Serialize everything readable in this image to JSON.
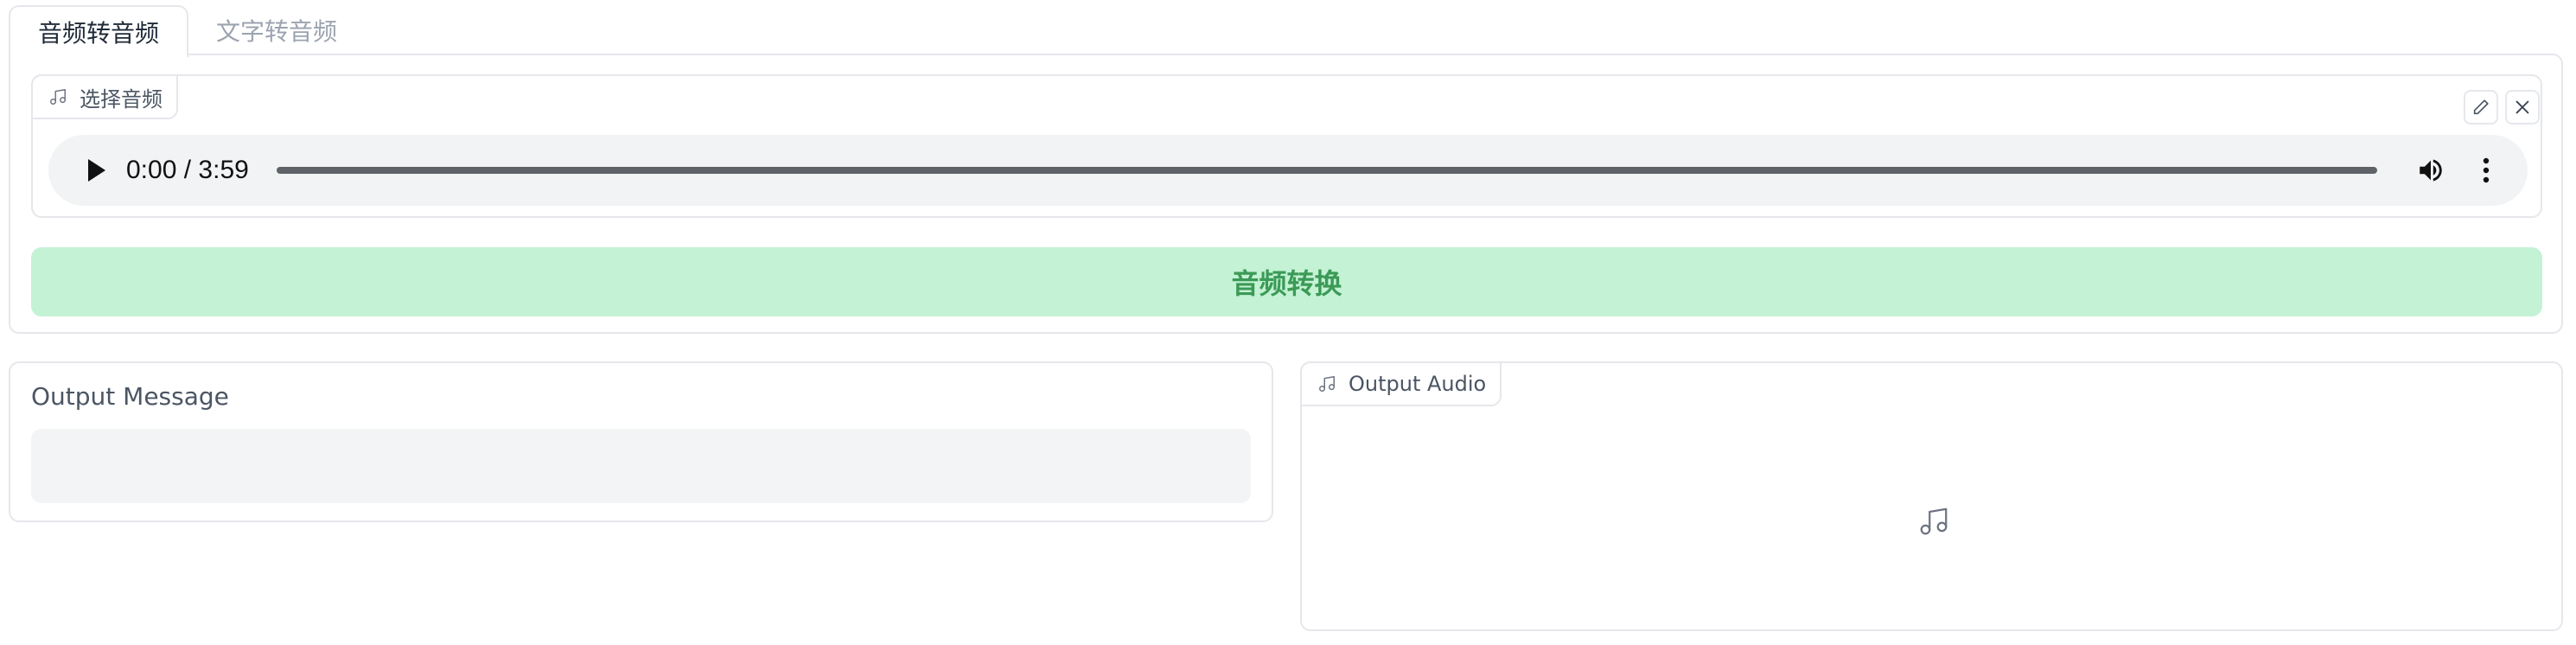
{
  "tabs": [
    {
      "label": "音频转音频",
      "active": true
    },
    {
      "label": "文字转音频",
      "active": false
    }
  ],
  "input_audio": {
    "label": "选择音频",
    "label_icon": "music-note-icon",
    "edit_icon": "pencil-icon",
    "close_icon": "close-icon",
    "player": {
      "current_time": "0:00",
      "separator": "/",
      "duration": "3:59",
      "progress": 0
    }
  },
  "convert_button": {
    "label": "音频转换",
    "bg_color": "#c4f2d4",
    "text_color": "#3b9a57"
  },
  "output_message": {
    "label": "Output Message",
    "value": ""
  },
  "output_audio": {
    "label": "Output Audio",
    "label_icon": "music-note-icon",
    "placeholder_icon": "music-note-icon"
  }
}
